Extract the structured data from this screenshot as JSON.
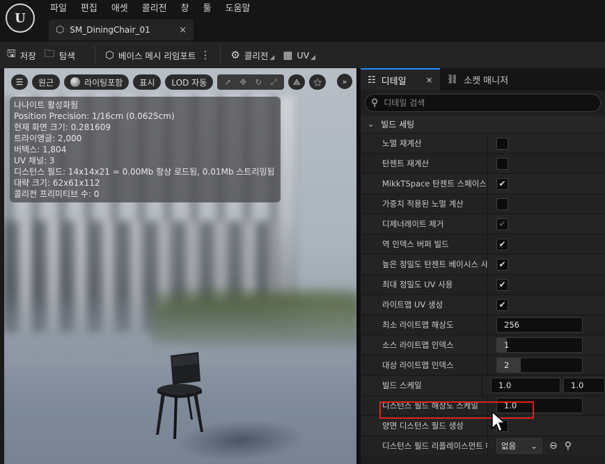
{
  "app": {
    "logo_text": "U",
    "menu": [
      "파일",
      "편집",
      "애셋",
      "콜리전",
      "창",
      "툴",
      "도움말"
    ],
    "asset_tab": {
      "label": "SM_DiningChair_01",
      "close": "×",
      "icon": "static-mesh-icon"
    }
  },
  "toolbar": {
    "save": "저장",
    "browse": "탐색",
    "reimport": "베이스 메시 리임포트",
    "more": "⋮",
    "collision": "콜리전",
    "uv": "UV"
  },
  "viewport": {
    "toolbar": {
      "menu": "☰",
      "perspective": "원근",
      "lighting": "라이팅포함",
      "show": "표시",
      "lod": "LOD 자동",
      "expand": "»"
    },
    "stats": [
      "나나이트 활성화됨",
      "Position Precision: 1/16cm (0.0625cm)",
      "현재 화면 크기: 0.281609",
      "트라이앵글: 2,000",
      "버텍스: 1,804",
      "UV 채널: 3",
      "디스턴스 필드: 14x14x21 = 0.00Mb 항상 로드됨, 0.01Mb 스트리밍됨",
      "대략 크기: 62x61x112",
      "콜리전 프리미티브 수: 0"
    ]
  },
  "details": {
    "tabs": [
      {
        "label": "디테일",
        "icon": "sliders-icon",
        "close": "×"
      },
      {
        "label": "소켓 매니저",
        "icon": "socket-icon"
      }
    ],
    "search_placeholder": "디테일 검색",
    "category": "빌드 세팅",
    "props": {
      "p1": {
        "label": "노멀 재계산",
        "checked": false
      },
      "p2": {
        "label": "탄젠트 재계산",
        "checked": false
      },
      "p3": {
        "label": "MikkTSpace 탄젠트 스페이스 사용",
        "checked": true,
        "mark": "✔"
      },
      "p4": {
        "label": "가중치 적용된 노멀 계산",
        "checked": false
      },
      "p5": {
        "label": "디제너레이트 제거",
        "checked": true,
        "disabled": true,
        "mark": "✔"
      },
      "p6": {
        "label": "역 인덱스 버퍼 빌드",
        "checked": true,
        "mark": "✔"
      },
      "p7": {
        "label": "높은 정밀도 탄젠트 베이시스 사용",
        "checked": true,
        "mark": "✔"
      },
      "p8": {
        "label": "최대 정밀도 UV 사용",
        "checked": true,
        "mark": "✔"
      },
      "p9": {
        "label": "라이트맵 UV 생성",
        "checked": true,
        "mark": "✔"
      },
      "p10": {
        "label": "최소 라이트맵 해상도",
        "value": "256"
      },
      "p11": {
        "label": "소스 라이트맵 인덱스",
        "value": "1"
      },
      "p12": {
        "label": "대상 라이트맵 인덱스",
        "value": "2"
      },
      "p13": {
        "label": "빌드 스케일",
        "x": "1.0",
        "y": "1.0"
      },
      "p14": {
        "label": "디스턴스 필드 해상도 스케일",
        "value": "1.0"
      },
      "p15": {
        "label": "양면 디스턴스 필드 생성",
        "checked": false
      },
      "p16": {
        "label": "디스턴스 필드 리플레이스먼트 메시",
        "value": "없음",
        "caret": "⌄"
      }
    }
  },
  "colors": {
    "accent": "#1e8cff",
    "highlight": "#e02020"
  }
}
